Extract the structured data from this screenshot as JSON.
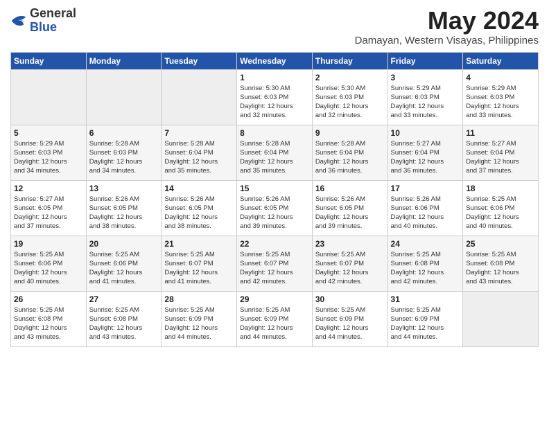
{
  "header": {
    "logo_general": "General",
    "logo_blue": "Blue",
    "month_title": "May 2024",
    "subtitle": "Damayan, Western Visayas, Philippines"
  },
  "weekdays": [
    "Sunday",
    "Monday",
    "Tuesday",
    "Wednesday",
    "Thursday",
    "Friday",
    "Saturday"
  ],
  "weeks": [
    [
      {
        "day": "",
        "info": ""
      },
      {
        "day": "",
        "info": ""
      },
      {
        "day": "",
        "info": ""
      },
      {
        "day": "1",
        "info": "Sunrise: 5:30 AM\nSunset: 6:03 PM\nDaylight: 12 hours\nand 32 minutes."
      },
      {
        "day": "2",
        "info": "Sunrise: 5:30 AM\nSunset: 6:03 PM\nDaylight: 12 hours\nand 32 minutes."
      },
      {
        "day": "3",
        "info": "Sunrise: 5:29 AM\nSunset: 6:03 PM\nDaylight: 12 hours\nand 33 minutes."
      },
      {
        "day": "4",
        "info": "Sunrise: 5:29 AM\nSunset: 6:03 PM\nDaylight: 12 hours\nand 33 minutes."
      }
    ],
    [
      {
        "day": "5",
        "info": "Sunrise: 5:29 AM\nSunset: 6:03 PM\nDaylight: 12 hours\nand 34 minutes."
      },
      {
        "day": "6",
        "info": "Sunrise: 5:28 AM\nSunset: 6:03 PM\nDaylight: 12 hours\nand 34 minutes."
      },
      {
        "day": "7",
        "info": "Sunrise: 5:28 AM\nSunset: 6:04 PM\nDaylight: 12 hours\nand 35 minutes."
      },
      {
        "day": "8",
        "info": "Sunrise: 5:28 AM\nSunset: 6:04 PM\nDaylight: 12 hours\nand 35 minutes."
      },
      {
        "day": "9",
        "info": "Sunrise: 5:28 AM\nSunset: 6:04 PM\nDaylight: 12 hours\nand 36 minutes."
      },
      {
        "day": "10",
        "info": "Sunrise: 5:27 AM\nSunset: 6:04 PM\nDaylight: 12 hours\nand 36 minutes."
      },
      {
        "day": "11",
        "info": "Sunrise: 5:27 AM\nSunset: 6:04 PM\nDaylight: 12 hours\nand 37 minutes."
      }
    ],
    [
      {
        "day": "12",
        "info": "Sunrise: 5:27 AM\nSunset: 6:05 PM\nDaylight: 12 hours\nand 37 minutes."
      },
      {
        "day": "13",
        "info": "Sunrise: 5:26 AM\nSunset: 6:05 PM\nDaylight: 12 hours\nand 38 minutes."
      },
      {
        "day": "14",
        "info": "Sunrise: 5:26 AM\nSunset: 6:05 PM\nDaylight: 12 hours\nand 38 minutes."
      },
      {
        "day": "15",
        "info": "Sunrise: 5:26 AM\nSunset: 6:05 PM\nDaylight: 12 hours\nand 39 minutes."
      },
      {
        "day": "16",
        "info": "Sunrise: 5:26 AM\nSunset: 6:05 PM\nDaylight: 12 hours\nand 39 minutes."
      },
      {
        "day": "17",
        "info": "Sunrise: 5:26 AM\nSunset: 6:06 PM\nDaylight: 12 hours\nand 40 minutes."
      },
      {
        "day": "18",
        "info": "Sunrise: 5:25 AM\nSunset: 6:06 PM\nDaylight: 12 hours\nand 40 minutes."
      }
    ],
    [
      {
        "day": "19",
        "info": "Sunrise: 5:25 AM\nSunset: 6:06 PM\nDaylight: 12 hours\nand 40 minutes."
      },
      {
        "day": "20",
        "info": "Sunrise: 5:25 AM\nSunset: 6:06 PM\nDaylight: 12 hours\nand 41 minutes."
      },
      {
        "day": "21",
        "info": "Sunrise: 5:25 AM\nSunset: 6:07 PM\nDaylight: 12 hours\nand 41 minutes."
      },
      {
        "day": "22",
        "info": "Sunrise: 5:25 AM\nSunset: 6:07 PM\nDaylight: 12 hours\nand 42 minutes."
      },
      {
        "day": "23",
        "info": "Sunrise: 5:25 AM\nSunset: 6:07 PM\nDaylight: 12 hours\nand 42 minutes."
      },
      {
        "day": "24",
        "info": "Sunrise: 5:25 AM\nSunset: 6:08 PM\nDaylight: 12 hours\nand 42 minutes."
      },
      {
        "day": "25",
        "info": "Sunrise: 5:25 AM\nSunset: 6:08 PM\nDaylight: 12 hours\nand 43 minutes."
      }
    ],
    [
      {
        "day": "26",
        "info": "Sunrise: 5:25 AM\nSunset: 6:08 PM\nDaylight: 12 hours\nand 43 minutes."
      },
      {
        "day": "27",
        "info": "Sunrise: 5:25 AM\nSunset: 6:08 PM\nDaylight: 12 hours\nand 43 minutes."
      },
      {
        "day": "28",
        "info": "Sunrise: 5:25 AM\nSunset: 6:09 PM\nDaylight: 12 hours\nand 44 minutes."
      },
      {
        "day": "29",
        "info": "Sunrise: 5:25 AM\nSunset: 6:09 PM\nDaylight: 12 hours\nand 44 minutes."
      },
      {
        "day": "30",
        "info": "Sunrise: 5:25 AM\nSunset: 6:09 PM\nDaylight: 12 hours\nand 44 minutes."
      },
      {
        "day": "31",
        "info": "Sunrise: 5:25 AM\nSunset: 6:09 PM\nDaylight: 12 hours\nand 44 minutes."
      },
      {
        "day": "",
        "info": ""
      }
    ]
  ]
}
